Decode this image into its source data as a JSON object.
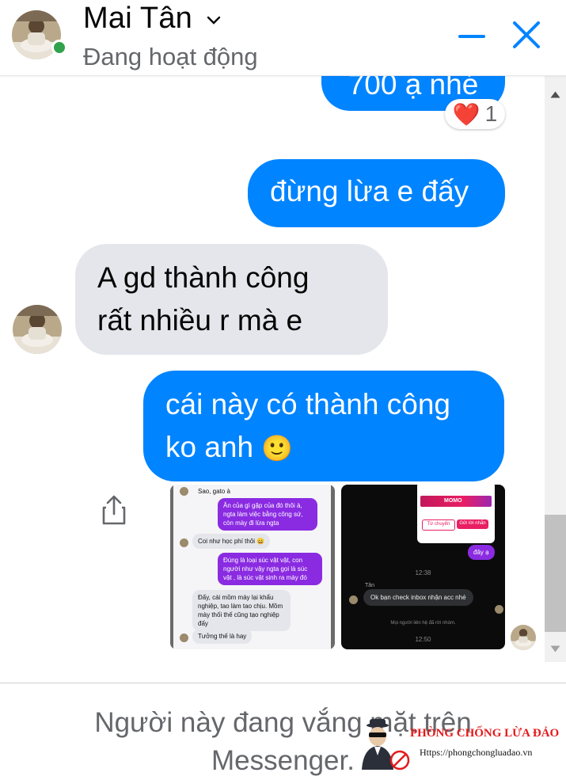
{
  "header": {
    "contact_name": "Mai Tân",
    "status": "Đang hoạt động",
    "minimize_label": "Minimize chat",
    "close_label": "Close chat"
  },
  "messages": [
    {
      "direction": "outgoing",
      "text": "700 ạ nhé",
      "reaction": {
        "emoji": "❤️",
        "count": "1"
      }
    },
    {
      "direction": "outgoing",
      "text": "đừng lừa e đấy"
    },
    {
      "direction": "incoming",
      "lines": [
        "A gd thành công",
        "rất nhiều r mà e"
      ]
    },
    {
      "direction": "outgoing",
      "lines": [
        "cái này có thành công",
        "ko anh"
      ],
      "emoji": "🙂"
    }
  ],
  "attachment_left": {
    "messages": [
      {
        "side": "in",
        "text": "Sao, gato à"
      },
      {
        "side": "out",
        "text": "Ăn của gì gặp của đó thôi à, ngta làm việc bằng công sứ, còn mày đi lừa ngta"
      },
      {
        "side": "in",
        "text": "Coi như học phí thôi 😄"
      },
      {
        "side": "out",
        "text": "Đúng là loại súc vật vật, con người như vậy ngta gọi là súc vật , là súc vật sinh ra mày đó"
      },
      {
        "side": "in",
        "text": "Đấy, cái mồm mày lại khẩu nghiệp, tao làm tao chịu. Mồm mày thối thế cũng tạo nghiệp đấy"
      },
      {
        "side": "in",
        "text": "Tưởng thế là hay"
      }
    ]
  },
  "attachment_right": {
    "card_title": "MOMO",
    "btn_left": "Từ chuyển",
    "btn_right": "Gửi lời nhắn",
    "reply": "đây ạ",
    "time1": "12:38",
    "sender": "Tân",
    "incoming": "Ok bạn check inbox nhận acc nhé",
    "system": "Mọi người liên hệ đã rời nhóm.",
    "time2": "12:50"
  },
  "footer": {
    "message_line1": "Người này đang vắng mặt trên",
    "message_line2": "Messenger."
  },
  "watermark": {
    "title": "PHÒNG CHỐNG LỪA ĐẢO",
    "url": "Https://phongchongluadao.vn"
  },
  "colors": {
    "outgoing_bubble": "#0084ff",
    "incoming_bubble": "#e4e6eb",
    "online_dot": "#31a24c",
    "header_icons": "#0084ff"
  }
}
